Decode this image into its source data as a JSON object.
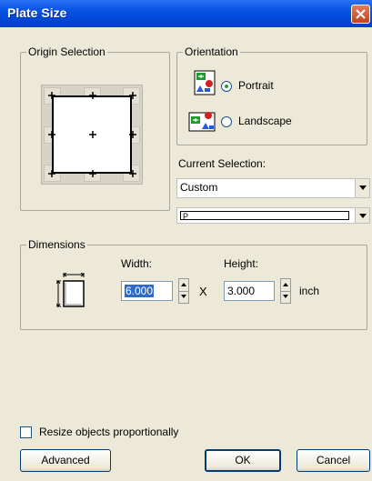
{
  "window": {
    "title": "Plate Size"
  },
  "origin_group": {
    "legend": "Origin Selection"
  },
  "orientation_group": {
    "legend": "Orientation",
    "portrait_label": "Portrait",
    "landscape_label": "Landscape",
    "selected": "Portrait"
  },
  "current_selection": {
    "label": "Current Selection:",
    "value": "Custom",
    "second_value": "P"
  },
  "dimensions_group": {
    "legend": "Dimensions",
    "width_label": "Width:",
    "width_value": "6.000",
    "times": "X",
    "height_label": "Height:",
    "height_value": "3.000",
    "unit": "inch"
  },
  "footer": {
    "resize_label": "Resize objects proportionally",
    "advanced_label": "Advanced",
    "ok_label": "OK",
    "cancel_label": "Cancel"
  },
  "colors": {
    "title_bar": "#0a56e6",
    "window_bg": "#ece9d8",
    "selection": "#316ac5"
  }
}
